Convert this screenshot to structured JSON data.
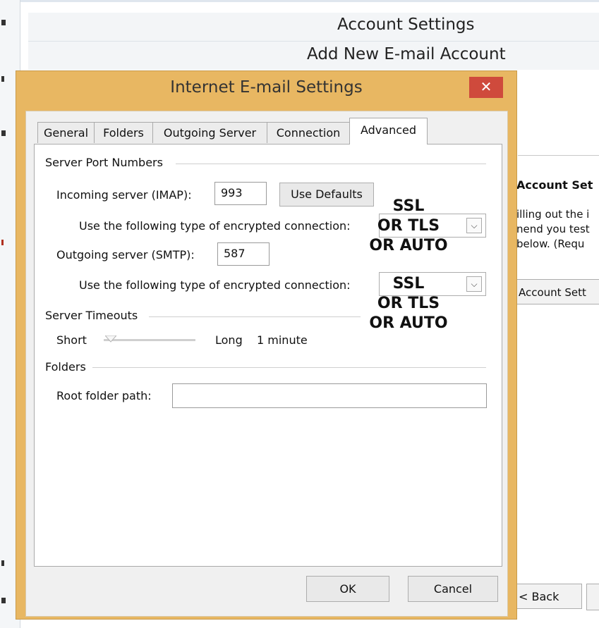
{
  "background_window": {
    "title": "Account Settings",
    "subtitle": "Add New E-mail Account",
    "right_heading": "Account Set",
    "right_text": [
      "illing out the i",
      "nend you test",
      " below. (Requ"
    ],
    "account_settings_button": "Account Sett",
    "back_button": "< Back"
  },
  "dialog": {
    "title": "Internet E-mail Settings",
    "close_label": "✕",
    "tabs": [
      {
        "label": "General"
      },
      {
        "label": "Folders"
      },
      {
        "label": "Outgoing Server"
      },
      {
        "label": "Connection"
      },
      {
        "label": "Advanced"
      }
    ],
    "active_tab": "Advanced",
    "server_ports": {
      "group_title": "Server Port Numbers",
      "incoming_label": "Incoming server (IMAP):",
      "incoming_value": "993",
      "use_defaults_label": "Use Defaults",
      "incoming_encryption_label": "Use the following type of encrypted connection:",
      "outgoing_label": "Outgoing server (SMTP):",
      "outgoing_value": "587",
      "outgoing_encryption_label": "Use the following type of encrypted connection:"
    },
    "annotation": {
      "lines": [
        "SSL",
        "OR TLS",
        "OR AUTO"
      ]
    },
    "timeouts": {
      "group_title": "Server Timeouts",
      "short_label": "Short",
      "long_label": "Long",
      "value": "1 minute"
    },
    "folders": {
      "group_title": "Folders",
      "root_label": "Root folder path:",
      "root_value": ""
    },
    "ok_label": "OK",
    "cancel_label": "Cancel"
  },
  "colors": {
    "dialog_frame": "#e8b762",
    "close_button": "#cf4a3c"
  }
}
